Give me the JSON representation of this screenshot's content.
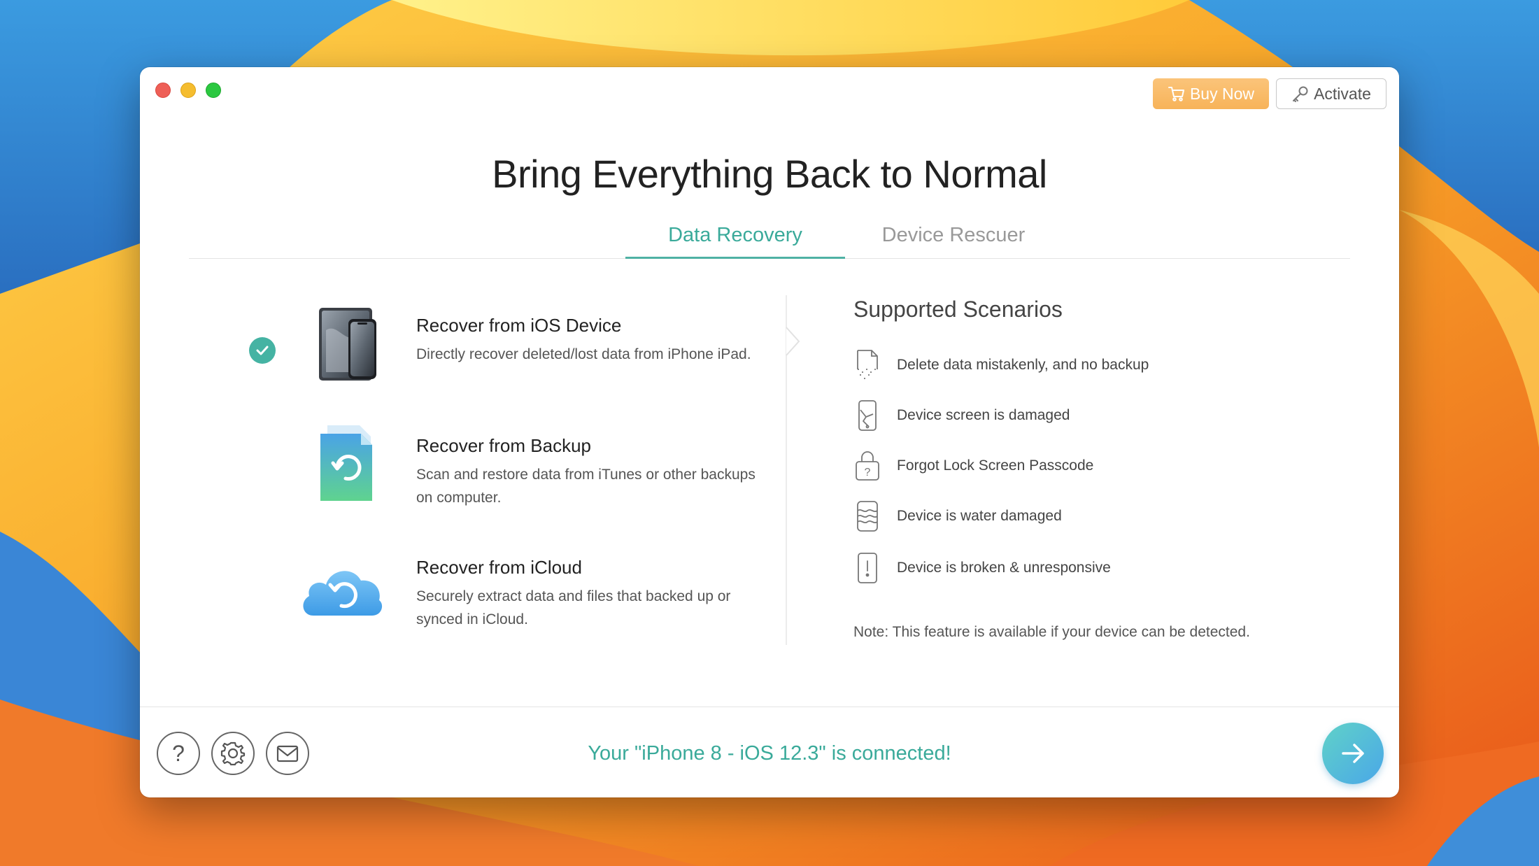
{
  "window": {
    "buy_now_label": "Buy Now",
    "activate_label": "Activate",
    "title": "Bring Everything Back to Normal"
  },
  "tabs": [
    {
      "label": "Data Recovery",
      "active": true
    },
    {
      "label": "Device Rescuer",
      "active": false
    }
  ],
  "options": [
    {
      "title": "Recover from iOS Device",
      "desc": "Directly recover deleted/lost data from iPhone iPad.",
      "selected": true,
      "icon": "ios-device-icon"
    },
    {
      "title": "Recover from Backup",
      "desc": "Scan and restore data from iTunes or other backups on computer.",
      "selected": false,
      "icon": "backup-file-icon"
    },
    {
      "title": "Recover from iCloud",
      "desc": "Securely extract data and files that backed up or synced in iCloud.",
      "selected": false,
      "icon": "icloud-icon"
    }
  ],
  "scenarios": {
    "title": "Supported Scenarios",
    "items": [
      {
        "text": "Delete data mistakenly, and no backup",
        "icon": "deleted-file-icon"
      },
      {
        "text": "Device screen is damaged",
        "icon": "broken-screen-icon"
      },
      {
        "text": "Forgot Lock Screen Passcode",
        "icon": "lock-question-icon"
      },
      {
        "text": "Device is water damaged",
        "icon": "water-damage-icon"
      },
      {
        "text": "Device is broken & unresponsive",
        "icon": "device-alert-icon"
      }
    ],
    "note": "Note: This feature is available if your device can be detected."
  },
  "footer": {
    "status": "Your \"iPhone 8 - iOS 12.3\" is connected!"
  },
  "colors": {
    "accent": "#3aaa9a",
    "buy_button": "#f7b359",
    "check": "#45b3a3"
  }
}
